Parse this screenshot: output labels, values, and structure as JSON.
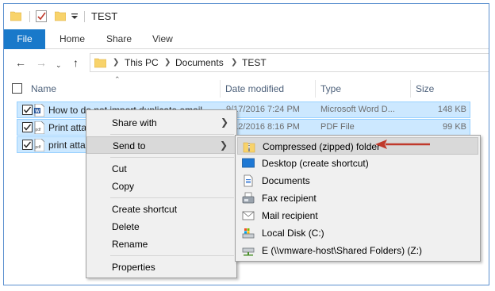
{
  "window": {
    "title": "TEST"
  },
  "ribbon": {
    "tabs": [
      "File",
      "Home",
      "Share",
      "View"
    ]
  },
  "address": {
    "breadcrumbs": [
      "This PC",
      "Documents",
      "TEST"
    ]
  },
  "columns": {
    "name": "Name",
    "date_modified": "Date modified",
    "type": "Type",
    "size": "Size"
  },
  "files": [
    {
      "name": "How to do not import duplicate email",
      "date": "9/17/2016 7:24 PM",
      "type": "Microsoft Word D...",
      "size": "148 KB",
      "icon": "word-document-icon"
    },
    {
      "name": "Print atta",
      "date": "9/12/2016 8:16 PM",
      "type": "PDF File",
      "size": "99 KB",
      "icon": "pdf-file-icon"
    },
    {
      "name": "print atta",
      "date": "",
      "type": "",
      "size": "",
      "icon": "pdf-file-icon"
    }
  ],
  "context_menu": {
    "items": [
      {
        "label": "Share with",
        "has_submenu": true
      },
      {
        "label": "Send to",
        "has_submenu": true,
        "highlighted": true
      },
      {
        "label": "Cut"
      },
      {
        "label": "Copy"
      },
      {
        "label": "Create shortcut"
      },
      {
        "label": "Delete"
      },
      {
        "label": "Rename"
      },
      {
        "label": "Properties"
      }
    ]
  },
  "send_to_menu": {
    "items": [
      {
        "label": "Compressed (zipped) folder",
        "icon": "zip-folder-icon",
        "highlighted": true
      },
      {
        "label": "Desktop (create shortcut)",
        "icon": "desktop-icon"
      },
      {
        "label": "Documents",
        "icon": "documents-icon"
      },
      {
        "label": "Fax recipient",
        "icon": "fax-icon"
      },
      {
        "label": "Mail recipient",
        "icon": "mail-icon"
      },
      {
        "label": "Local Disk (C:)",
        "icon": "local-disk-icon"
      },
      {
        "label": "E (\\\\vmware-host\\Shared Folders) (Z:)",
        "icon": "network-drive-icon"
      }
    ]
  },
  "colors": {
    "accent": "#1979ca",
    "selection": "#cce8ff",
    "annotation_arrow": "#c0392b"
  }
}
